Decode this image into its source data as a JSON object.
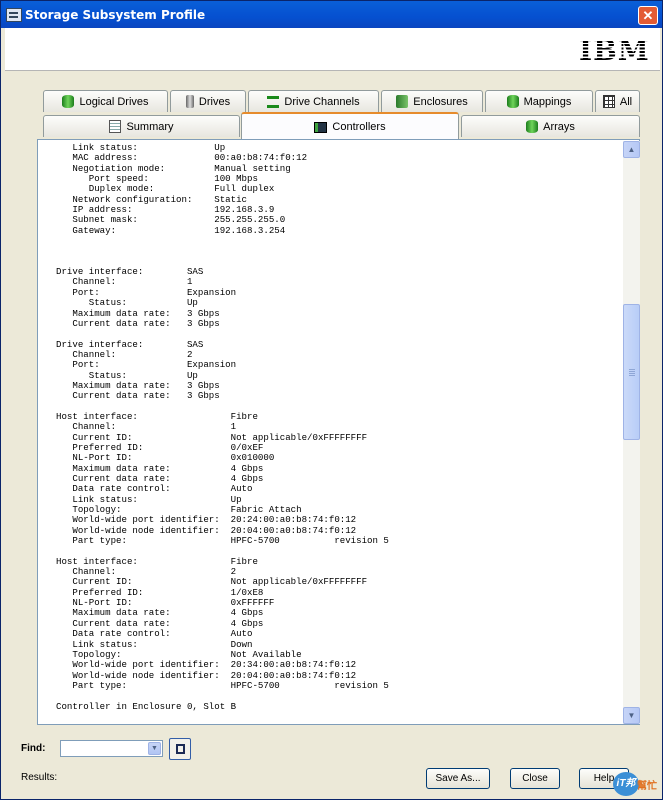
{
  "window": {
    "title": "Storage Subsystem Profile"
  },
  "logo": {
    "text": "IBM"
  },
  "tabs_row1": [
    {
      "label": "Logical Drives",
      "icon": "logical-drives-icon"
    },
    {
      "label": "Drives",
      "icon": "drive-icon"
    },
    {
      "label": "Drive Channels",
      "icon": "drive-channels-icon"
    },
    {
      "label": "Enclosures",
      "icon": "enclosures-icon"
    },
    {
      "label": "Mappings",
      "icon": "mappings-icon"
    },
    {
      "label": "All",
      "icon": "grid-icon"
    }
  ],
  "tabs_row2": [
    {
      "label": "Summary",
      "icon": "document-icon"
    },
    {
      "label": "Controllers",
      "icon": "controller-icon",
      "active": true
    },
    {
      "label": "Arrays",
      "icon": "arrays-icon"
    }
  ],
  "profile_lines": [
    "   Link status:              Up",
    "   MAC address:              00:a0:b8:74:f0:12",
    "   Negotiation mode:         Manual setting",
    "      Port speed:            100 Mbps",
    "      Duplex mode:           Full duplex",
    "   Network configuration:    Static",
    "   IP address:               192.168.3.9",
    "   Subnet mask:              255.255.255.0",
    "   Gateway:                  192.168.3.254",
    "",
    "",
    "",
    "Drive interface:        SAS",
    "   Channel:             1",
    "   Port:                Expansion",
    "      Status:           Up",
    "   Maximum data rate:   3 Gbps",
    "   Current data rate:   3 Gbps",
    "",
    "Drive interface:        SAS",
    "   Channel:             2",
    "   Port:                Expansion",
    "      Status:           Up",
    "   Maximum data rate:   3 Gbps",
    "   Current data rate:   3 Gbps",
    "",
    "Host interface:                 Fibre",
    "   Channel:                     1",
    "   Current ID:                  Not applicable/0xFFFFFFFF",
    "   Preferred ID:                0/0xEF",
    "   NL-Port ID:                  0x010000",
    "   Maximum data rate:           4 Gbps",
    "   Current data rate:           4 Gbps",
    "   Data rate control:           Auto",
    "   Link status:                 Up",
    "   Topology:                    Fabric Attach",
    "   World-wide port identifier:  20:24:00:a0:b8:74:f0:12",
    "   World-wide node identifier:  20:04:00:a0:b8:74:f0:12",
    "   Part type:                   HPFC-5700          revision 5",
    "",
    "Host interface:                 Fibre",
    "   Channel:                     2",
    "   Current ID:                  Not applicable/0xFFFFFFFF",
    "   Preferred ID:                1/0xE8",
    "   NL-Port ID:                  0xFFFFFF",
    "   Maximum data rate:           4 Gbps",
    "   Current data rate:           4 Gbps",
    "   Data rate control:           Auto",
    "   Link status:                 Down",
    "   Topology:                    Not Available",
    "   World-wide port identifier:  20:34:00:a0:b8:74:f0:12",
    "   World-wide node identifier:  20:04:00:a0:b8:74:f0:12",
    "   Part type:                   HPFC-5700          revision 5",
    "",
    "Controller in Enclosure 0, Slot B"
  ],
  "find": {
    "label": "Find:",
    "value": ""
  },
  "results": {
    "label": "Results:"
  },
  "buttons": {
    "save_as": "Save As...",
    "close": "Close",
    "help": "Help"
  },
  "badge": {
    "circle": "iT邦",
    "text": "幫忙"
  }
}
